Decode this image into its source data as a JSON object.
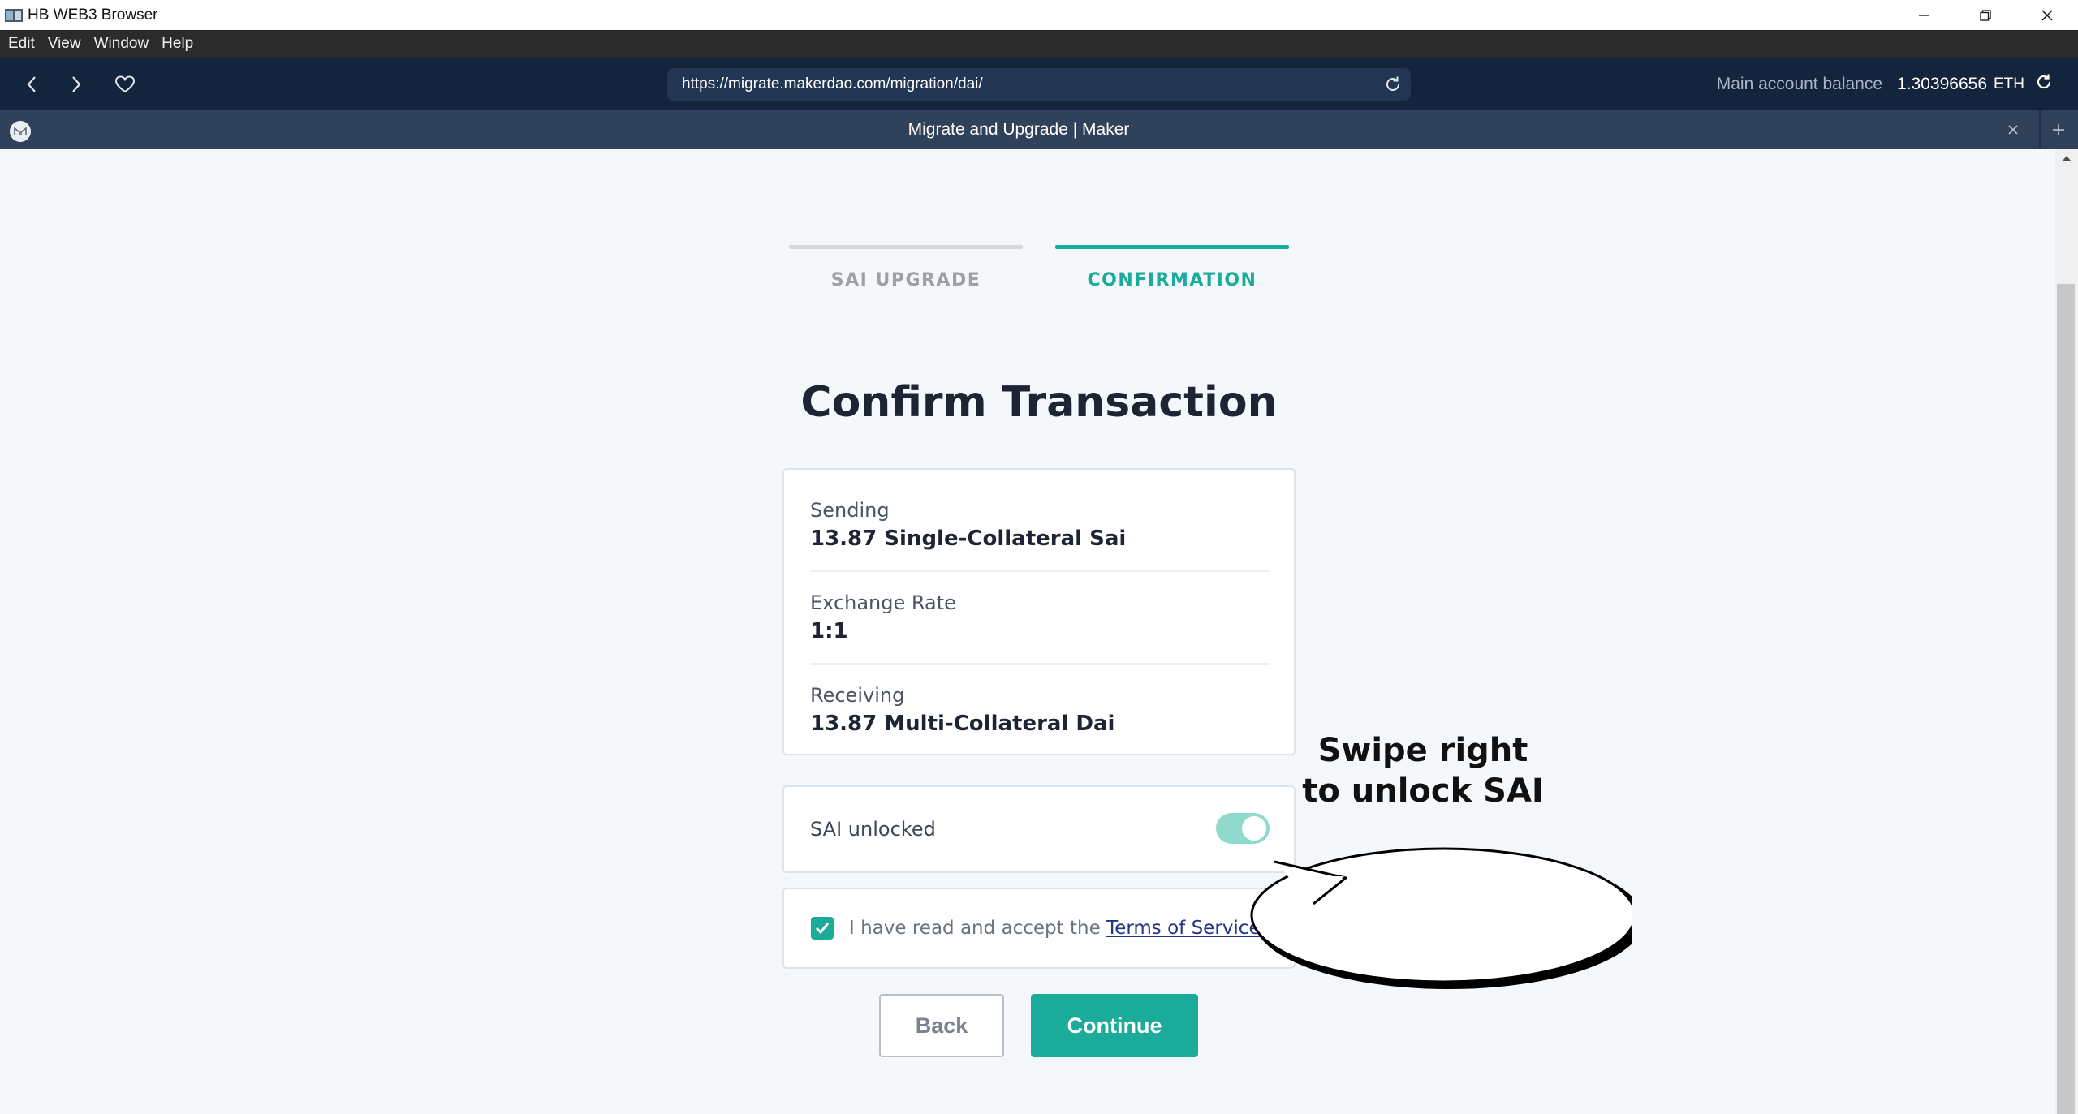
{
  "window": {
    "app_title": "HB WEB3 Browser"
  },
  "menu": [
    "Edit",
    "View",
    "Window",
    "Help"
  ],
  "navbar": {
    "url": "https://migrate.makerdao.com/migration/dai/",
    "balance_label": "Main account balance",
    "balance_value": "1.30396656",
    "balance_unit": "ETH"
  },
  "tab": {
    "title": "Migrate and Upgrade | Maker"
  },
  "colors": {
    "accent": "#1aab9b",
    "nav_bg": "#14243d",
    "tab_bg": "#30415a"
  },
  "steps": [
    {
      "label": "SAI UPGRADE",
      "active": false
    },
    {
      "label": "CONFIRMATION",
      "active": true
    }
  ],
  "heading": "Confirm Transaction",
  "summary": [
    {
      "label": "Sending",
      "value": "13.87 Single-Collateral Sai"
    },
    {
      "label": "Exchange Rate",
      "value": "1:1"
    },
    {
      "label": "Receiving",
      "value": "13.87 Multi-Collateral Dai"
    }
  ],
  "unlock": {
    "label": "SAI unlocked",
    "enabled": true
  },
  "terms": {
    "prefix": "I have read and accept the",
    "link": "Terms of Service",
    "suffix": ".",
    "checked": true
  },
  "buttons": {
    "back": "Back",
    "continue": "Continue"
  },
  "callout": {
    "line1": "Swipe right",
    "line2": "to unlock SAI"
  }
}
